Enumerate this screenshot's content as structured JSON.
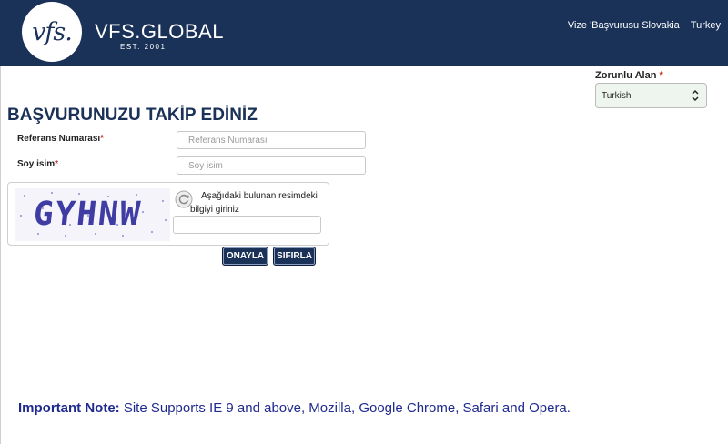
{
  "header": {
    "logo_text": "vfs.",
    "brand": "VFS.GLOBAL",
    "est": "EST. 2001",
    "nav": [
      "Vize 'Başvurusu Slovakia",
      "Turkey"
    ]
  },
  "language": {
    "label": "Zorunlu Alan",
    "required_mark": "*",
    "selected": "Turkish"
  },
  "page_title": "BAŞVURUNUZU TAKİP EDİNİZ",
  "form": {
    "reference": {
      "label": "Referans Numarası",
      "required_mark": "*",
      "placeholder": "Referans Numarası"
    },
    "surname": {
      "label": "Soy isim",
      "required_mark": "*",
      "placeholder": "Soy isim"
    }
  },
  "captcha": {
    "image_text": "GYHNW",
    "instruction": "Aşağıdaki bulunan resimdeki bilgiyi giriniz"
  },
  "buttons": {
    "confirm": "ONAYLA",
    "reset": "SIFIRLA"
  },
  "note": {
    "label": "Important Note:",
    "text": " Site Supports IE 9 and above, Mozilla, Google Chrome, Safari and Opera."
  },
  "colors": {
    "header_bg": "#1a3158",
    "note_text": "#1f2a8f",
    "required": "#c0392b"
  }
}
